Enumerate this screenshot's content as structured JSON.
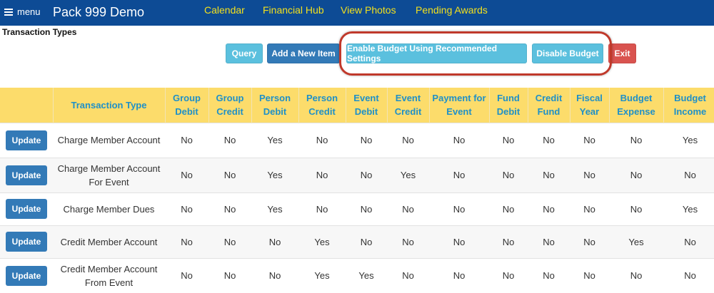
{
  "header": {
    "menu_label": "menu",
    "brand": "Pack 999 Demo",
    "nav": [
      "Calendar",
      "Financial Hub",
      "View Photos",
      "Pending Awards"
    ]
  },
  "page_title": "Transaction Types",
  "toolbar": {
    "query": "Query",
    "add": "Add a New Item",
    "enable_budget": "Enable Budget Using Recommended Settings",
    "disable_budget": "Disable Budget",
    "exit": "Exit"
  },
  "colors": {
    "header_bg": "#0d4b95",
    "nav_link": "#f3e01c",
    "table_header_bg": "#fcdc6b",
    "table_header_text": "#1e90c8",
    "primary_button": "#337ab7",
    "info_button": "#5bc0de",
    "danger_button": "#d9534f",
    "highlight_ring": "#c0392b"
  },
  "table": {
    "columns": [
      "",
      "Transaction Type",
      "Group Debit",
      "Group Credit",
      "Person Debit",
      "Person Credit",
      "Event Debit",
      "Event Credit",
      "Payment for Event",
      "Fund Debit",
      "Credit Fund",
      "Fiscal Year",
      "Budget Expense",
      "Budget Income"
    ],
    "update_label": "Update",
    "rows": [
      [
        "Charge Member Account",
        "No",
        "No",
        "Yes",
        "No",
        "No",
        "No",
        "No",
        "No",
        "No",
        "No",
        "No",
        "Yes"
      ],
      [
        "Charge Member Account For Event",
        "No",
        "No",
        "Yes",
        "No",
        "No",
        "Yes",
        "No",
        "No",
        "No",
        "No",
        "No",
        "No"
      ],
      [
        "Charge Member Dues",
        "No",
        "No",
        "Yes",
        "No",
        "No",
        "No",
        "No",
        "No",
        "No",
        "No",
        "No",
        "Yes"
      ],
      [
        "Credit Member Account",
        "No",
        "No",
        "No",
        "Yes",
        "No",
        "No",
        "No",
        "No",
        "No",
        "No",
        "Yes",
        "No"
      ],
      [
        "Credit Member Account From Event",
        "No",
        "No",
        "No",
        "Yes",
        "Yes",
        "No",
        "No",
        "No",
        "No",
        "No",
        "No",
        "No"
      ]
    ]
  }
}
